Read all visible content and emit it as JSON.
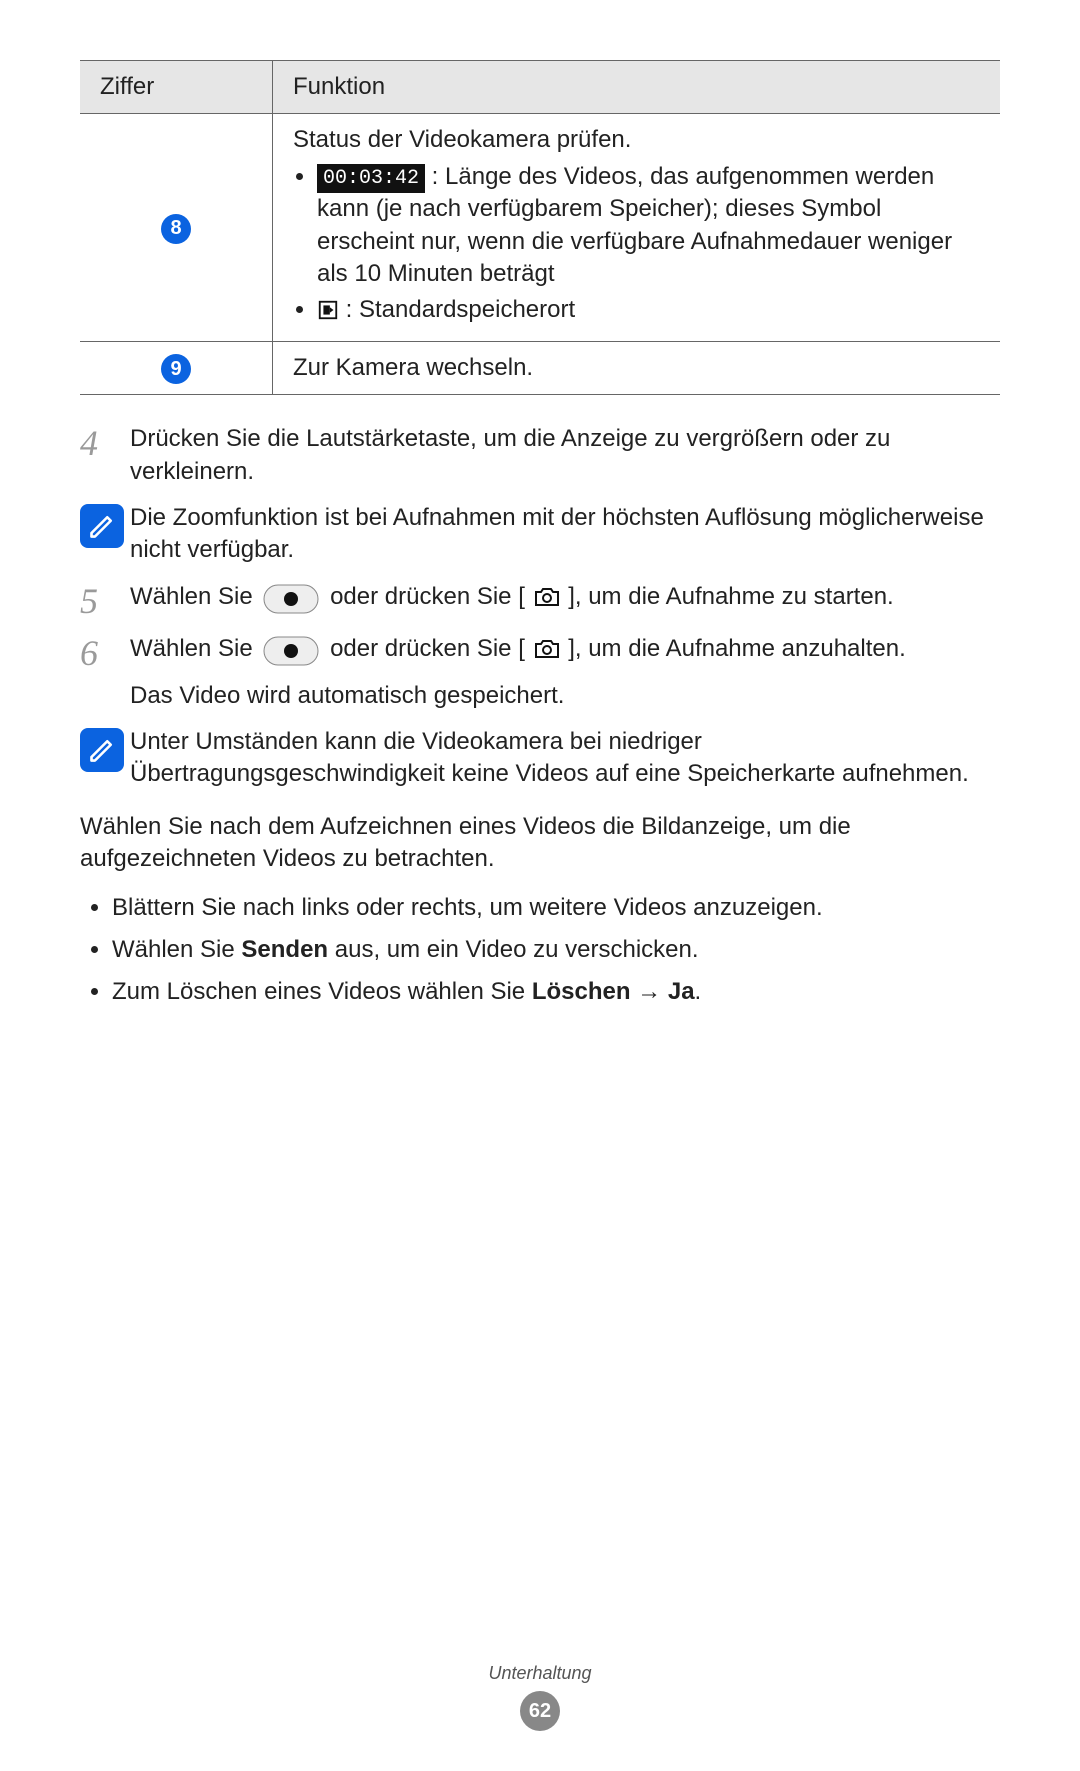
{
  "table": {
    "header": {
      "col1": "Ziffer",
      "col2": "Funktion"
    },
    "rows": [
      {
        "num": "8",
        "title": "Status der Videokamera prüfen.",
        "bullets": [
          {
            "prefix_time": "00:03:42",
            "text": " : Länge des Videos, das aufgenommen werden kann (je nach verfügbarem Speicher); dieses Symbol erscheint nur, wenn die verfügbare Aufnahmedauer weniger als 10 Minuten beträgt"
          },
          {
            "icon": "storage",
            "text": " : Standardspeicherort"
          }
        ]
      },
      {
        "num": "9",
        "text": "Zur Kamera wechseln."
      }
    ]
  },
  "steps": {
    "s4": {
      "num": "4",
      "text": "Drücken Sie die Lautstärketaste, um die Anzeige zu vergrößern oder zu verkleinern."
    },
    "note1": "Die Zoomfunktion ist bei Aufnahmen mit der höchsten Auflösung möglicherweise nicht verfügbar.",
    "s5": {
      "num": "5",
      "a": "Wählen Sie ",
      "b": " oder drücken Sie [",
      "c": "], um die Aufnahme zu starten."
    },
    "s6": {
      "num": "6",
      "a": "Wählen Sie ",
      "b": " oder drücken Sie [",
      "c": "], um die Aufnahme anzuhalten.",
      "d": "Das Video wird automatisch gespeichert."
    },
    "note2": "Unter Umständen kann die Videokamera bei niedriger Übertragungsgeschwindigkeit keine Videos auf eine Speicherkarte aufnehmen."
  },
  "after": {
    "para": "Wählen Sie nach dem Aufzeichnen eines Videos die Bildanzeige, um die aufgezeichneten Videos zu betrachten.",
    "bullets": {
      "b1": "Blättern Sie nach links oder rechts, um weitere Videos anzuzeigen.",
      "b2a": "Wählen Sie ",
      "b2bold": "Senden",
      "b2b": " aus, um ein Video zu verschicken.",
      "b3a": "Zum Löschen eines Videos wählen Sie ",
      "b3bold1": "Löschen",
      "b3arrow": " → ",
      "b3bold2": "Ja",
      "b3end": "."
    }
  },
  "footer": {
    "section": "Unterhaltung",
    "page": "62"
  }
}
